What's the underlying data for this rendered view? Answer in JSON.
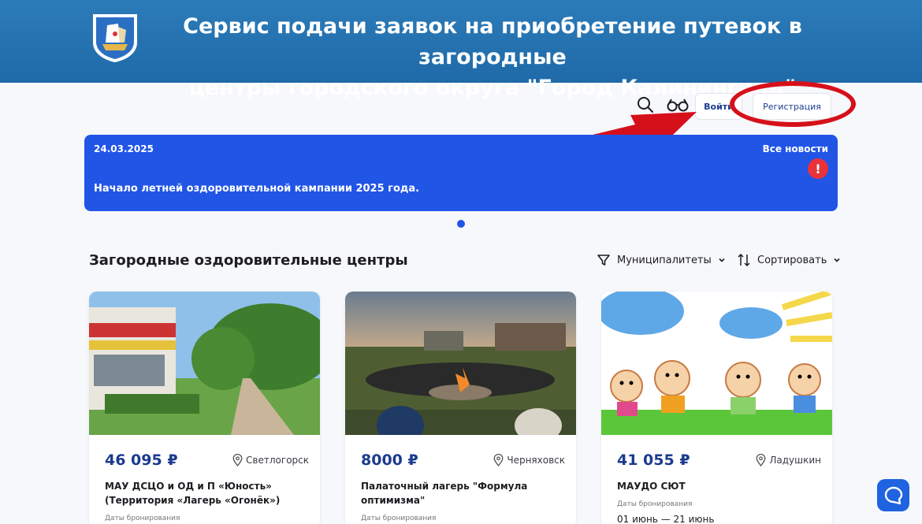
{
  "header": {
    "title_line1": "Сервис подачи заявок на приобретение путевок в загородные",
    "title_line2": "центры городского округа \"Город Калининград\""
  },
  "toolbar": {
    "login_label": "Войти",
    "register_label": "Регистрация"
  },
  "news": {
    "date": "24.03.2025",
    "all_news_label": "Все новости",
    "alert_glyph": "!",
    "headline": "Начало летней оздоровительной кампании 2025 года."
  },
  "section": {
    "title": "Загородные оздоровительные центры",
    "filter_label": "Муниципалитеты",
    "sort_label": "Сортировать"
  },
  "cards": [
    {
      "price": "46 095 ₽",
      "location": "Светлогорск",
      "name": "МАУ ДСЦО и ОД и П «Юность» (Территория «Лагерь «Огонёк»)",
      "dates_label": "Даты бронирования",
      "dates": ""
    },
    {
      "price": "8000 ₽",
      "location": "Черняховск",
      "name": "Палаточный лагерь \"Формула оптимизма\"",
      "dates_label": "Даты бронирования",
      "dates": ""
    },
    {
      "price": "41 055 ₽",
      "location": "Ладушкин",
      "name": "МАУДО СЮТ",
      "dates_label": "Даты бронирования",
      "dates": "01 июнь — 21 июнь"
    }
  ],
  "colors": {
    "header_bg": "#2c7bb9",
    "news_bg": "#2155e6",
    "price_color": "#1c3b8f",
    "annotation_red": "#d6101a",
    "chat_bg": "#1f63e0"
  },
  "icons": [
    "crest-logo",
    "search-icon",
    "accessibility-glasses-icon",
    "alert-icon",
    "filter-funnel-icon",
    "sort-arrows-icon",
    "chevron-down-icon",
    "location-pin-icon",
    "chat-icon"
  ]
}
